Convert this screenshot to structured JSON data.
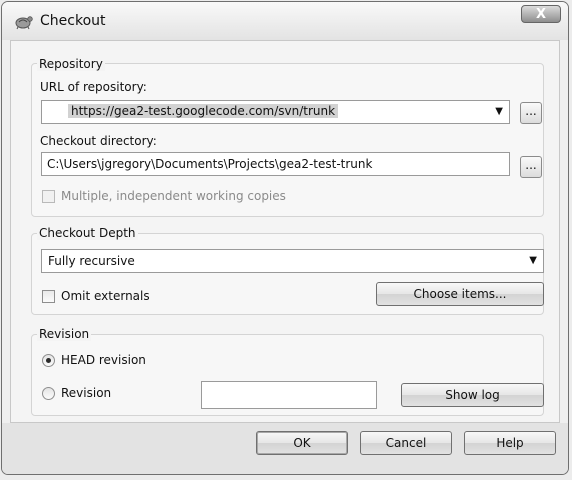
{
  "window": {
    "title": "Checkout",
    "icon": "tortoisesvn-icon",
    "close_label": "X"
  },
  "repository": {
    "group_label": "Repository",
    "url_label": "URL of repository:",
    "url_value": "https://gea2-test.googlecode.com/svn/trunk",
    "browse_label": "...",
    "dir_label": "Checkout directory:",
    "dir_value": "C:\\Users\\jgregory\\Documents\\Projects\\gea2-test-trunk",
    "multiple_label": "Multiple, independent working copies",
    "multiple_checked": false,
    "multiple_enabled": false
  },
  "depth": {
    "group_label": "Checkout Depth",
    "selected": "Fully recursive",
    "omit_label": "Omit externals",
    "omit_checked": false,
    "choose_label": "Choose items..."
  },
  "revision": {
    "group_label": "Revision",
    "head_label": "HEAD revision",
    "head_selected": true,
    "rev_label": "Revision",
    "rev_value": "",
    "showlog_label": "Show log"
  },
  "buttons": {
    "ok": "OK",
    "cancel": "Cancel",
    "help": "Help"
  }
}
